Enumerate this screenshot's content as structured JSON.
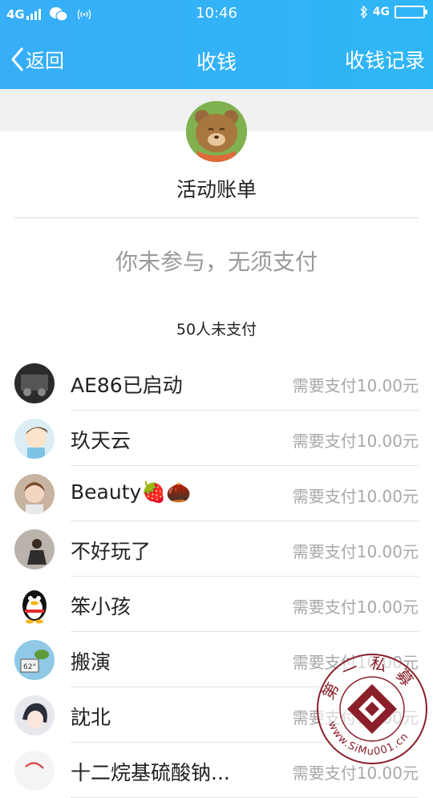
{
  "status_bar": {
    "network": "4G",
    "time": "10:46",
    "network_right": "4G"
  },
  "navbar": {
    "back_label": "返回",
    "title": "收钱",
    "record_label": "收钱记录"
  },
  "header": {
    "activity_title": "活动账单",
    "notice": "你未参与，无须支付",
    "unpaid_count": "50人未支付"
  },
  "members": [
    {
      "name": "AE86已启动",
      "amount": "需要支付10.00元",
      "avatar": "dark-photo-avatar"
    },
    {
      "name": "玖天云",
      "amount": "需要支付10.00元",
      "avatar": "cartoon-boy-avatar"
    },
    {
      "name": "Beauty🍓🌰",
      "amount": "需要支付10.00元",
      "avatar": "child-photo-avatar"
    },
    {
      "name": "不好玩了",
      "amount": "需要支付10.00元",
      "avatar": "sitting-girl-avatar"
    },
    {
      "name": "笨小孩",
      "amount": "需要支付10.00元",
      "avatar": "penguin-avatar"
    },
    {
      "name": "搬演",
      "amount": "需要支付10.00元",
      "avatar": "cartoon-62-avatar"
    },
    {
      "name": "訦北",
      "amount": "需要支付10.00元",
      "avatar": "anime-avatar"
    },
    {
      "name": "十二烷基硫酸钠...",
      "amount": "需要支付10.00元",
      "avatar": "sketch-avatar"
    }
  ],
  "watermark": {
    "top_text": "第一私募",
    "bottom_text": "www.SiMu001.cn"
  },
  "colors": {
    "header_blue": "#37aef8",
    "amount_gray": "#a8a8a8",
    "notice_gray": "#9a9a9a"
  }
}
